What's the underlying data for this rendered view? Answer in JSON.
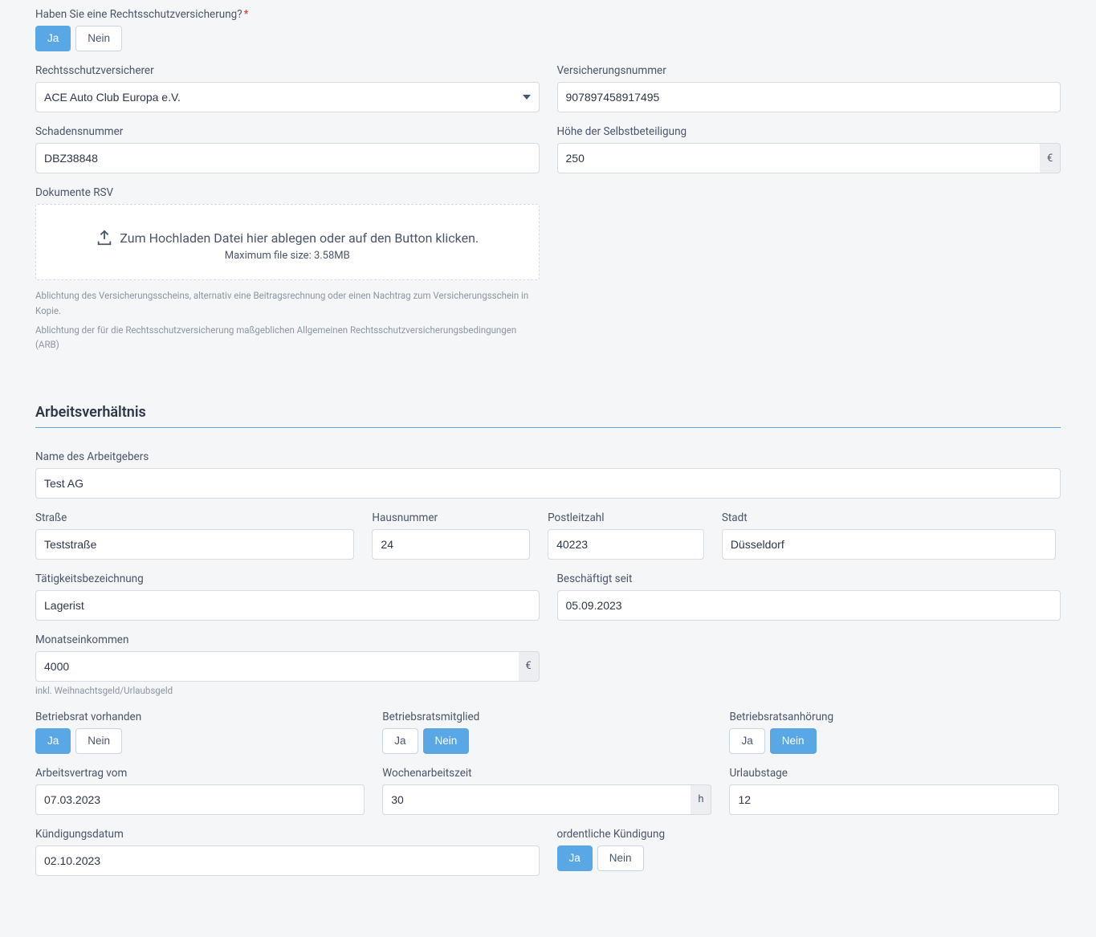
{
  "rsv": {
    "question_label": "Haben Sie eine Rechtsschutzversicherung?",
    "ja": "Ja",
    "nein": "Nein",
    "insurer_label": "Rechtsschutzversicherer",
    "insurer_value": "ACE Auto Club Europa e.V.",
    "policy_no_label": "Versicherungsnummer",
    "policy_no_value": "907897458917495",
    "claim_no_label": "Schadensnummer",
    "claim_no_value": "DBZ38848",
    "deductible_label": "Höhe der Selbstbeteiligung",
    "deductible_value": "250",
    "currency": "€",
    "documents_label": "Dokumente RSV",
    "upload_text": "Zum Hochladen Datei hier ablegen oder auf den Button klicken.",
    "upload_hint": "Maximum file size: 3.58MB",
    "help1": "Ablichtung des Versicherungsscheins, alternativ eine Beitragsrechnung oder einen Nachtrag zum Versicherungsschein in Kopie.",
    "help2": "Ablichtung der für die Rechtsschutzversicherung maßgeblichen Allgemeinen Rechtsschutzversicherungsbedingungen (ARB)"
  },
  "employment": {
    "section_title": "Arbeitsverhältnis",
    "employer_label": "Name des Arbeitgebers",
    "employer_value": "Test AG",
    "street_label": "Straße",
    "street_value": "Teststraße",
    "house_no_label": "Hausnummer",
    "house_no_value": "24",
    "zip_label": "Postleitzahl",
    "zip_value": "40223",
    "city_label": "Stadt",
    "city_value": "Düsseldorf",
    "job_title_label": "Tätigkeitsbezeichnung",
    "job_title_value": "Lagerist",
    "employed_since_label": "Beschäftigt seit",
    "employed_since_value": "05.09.2023",
    "income_label": "Monatseinkommen",
    "income_value": "4000",
    "income_hint": "inkl. Weihnachtsgeld/Urlaubsgeld",
    "works_council_exists_label": "Betriebsrat vorhanden",
    "works_council_member_label": "Betriebsratsmitglied",
    "works_council_hearing_label": "Betriebsratsanhörung",
    "contract_from_label": "Arbeitsvertrag vom",
    "contract_from_value": "07.03.2023",
    "weekly_hours_label": "Wochenarbeitszeit",
    "weekly_hours_value": "30",
    "hours_unit": "h",
    "vacation_label": "Urlaubstage",
    "vacation_value": "12",
    "termination_date_label": "Kündigungsdatum",
    "termination_date_value": "02.10.2023",
    "ordinary_termination_label": "ordentliche Kündigung",
    "ja": "Ja",
    "nein": "Nein"
  }
}
